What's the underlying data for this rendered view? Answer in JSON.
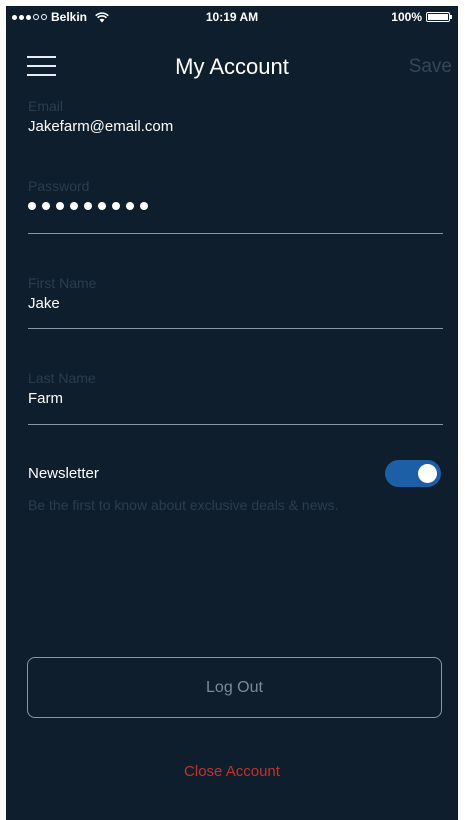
{
  "status_bar": {
    "carrier": "Belkin",
    "time": "10:19 AM",
    "battery": "100%",
    "battery_level": 1.0,
    "signal_bars_filled": 3,
    "signal_bars_total": 5,
    "icons": [
      "wifi-icon",
      "battery-icon"
    ]
  },
  "nav": {
    "title": "My Account",
    "save_label": "Save",
    "menu_icon": "menu-icon"
  },
  "form": {
    "email": {
      "label": "Email",
      "value": "Jakefarm@email.com"
    },
    "password": {
      "label": "Password",
      "masked_length": 9
    },
    "first_name": {
      "label": "First Name",
      "value": "Jake"
    },
    "last_name": {
      "label": "Last Name",
      "value": "Farm"
    }
  },
  "newsletter": {
    "title": "Newsletter",
    "description": "Be the first to know about exclusive deals & news.",
    "enabled": true
  },
  "actions": {
    "logout_label": "Log Out",
    "close_account_label": "Close Account"
  },
  "colors": {
    "background": "#0f1e2d",
    "toggle_on": "#1d5fa6",
    "danger": "#c0332b",
    "muted_label": "#2a3d50"
  }
}
